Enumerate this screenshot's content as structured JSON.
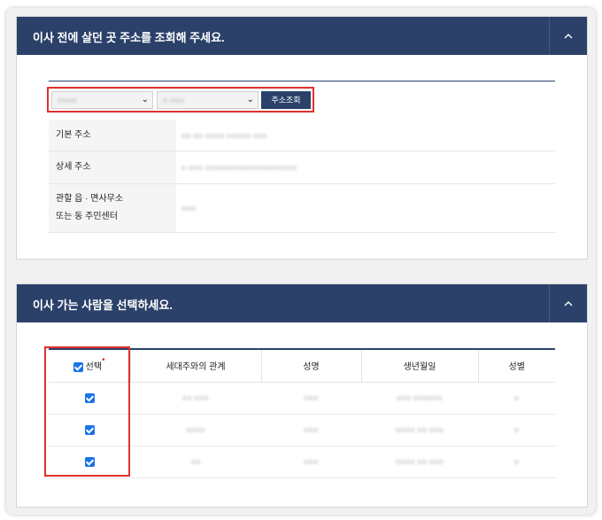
{
  "section1": {
    "title": "이사 전에 살던 곳 주소를 조회해 주세요.",
    "select1_value": "○○○○",
    "select2_value": "○ ○○○",
    "search_button": "주소조회",
    "rows": [
      {
        "label": "기본 주소",
        "value": "○○ ○○ ○○○○ ○○○○○ ○○○"
      },
      {
        "label": "상세 주소",
        "value": "○ ○○○ ○○○○○○○○○○○○○○○○○○○"
      },
      {
        "label": "관할 읍 · 면사무소",
        "label2": "또는 동 주민센터",
        "value": "○○○"
      }
    ]
  },
  "section2": {
    "title": "이사 가는 사람을 선택하세요.",
    "headers": [
      "선택",
      "세대주와의 관계",
      "성명",
      "생년월일",
      "성별"
    ],
    "required_mark": "•",
    "people": [
      {
        "relation": "○○ ○○○",
        "name": "○○○",
        "birth": "○○○ ○○○○○○",
        "gender": "○"
      },
      {
        "relation": "○○○○",
        "name": "○○○",
        "birth": "○○○○ ○○ ○○○",
        "gender": "○"
      },
      {
        "relation": "○○",
        "name": "○○○",
        "birth": "○○○○ ○○ ○○○",
        "gender": "○"
      }
    ]
  },
  "colors": {
    "header_bg": "#2b416a",
    "highlight": "#e0322c",
    "checkbox": "#1a73e8"
  }
}
